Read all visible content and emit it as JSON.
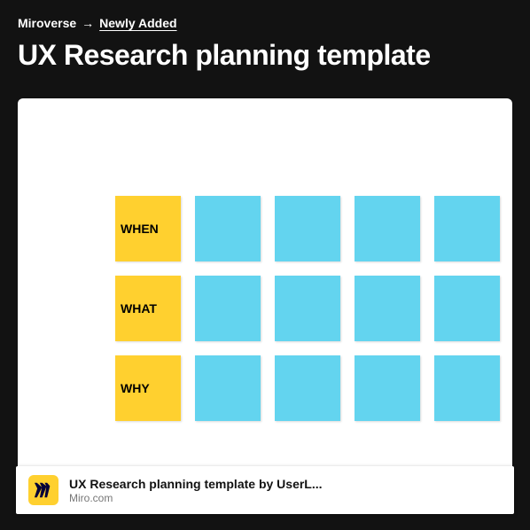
{
  "breadcrumb": {
    "root": "Miroverse",
    "arrow": "→",
    "current": "Newly Added"
  },
  "pageTitle": "UX Research planning template",
  "board": {
    "rows": [
      {
        "label": "WHEN",
        "blanks": 4
      },
      {
        "label": "WHAT",
        "blanks": 4
      },
      {
        "label": "WHY",
        "blanks": 4
      }
    ]
  },
  "linkCard": {
    "title": "UX Research planning template by UserL...",
    "domain": "Miro.com"
  },
  "colors": {
    "yellow": "#ffd02f",
    "blue": "#63d4ef",
    "bg": "#121212"
  }
}
